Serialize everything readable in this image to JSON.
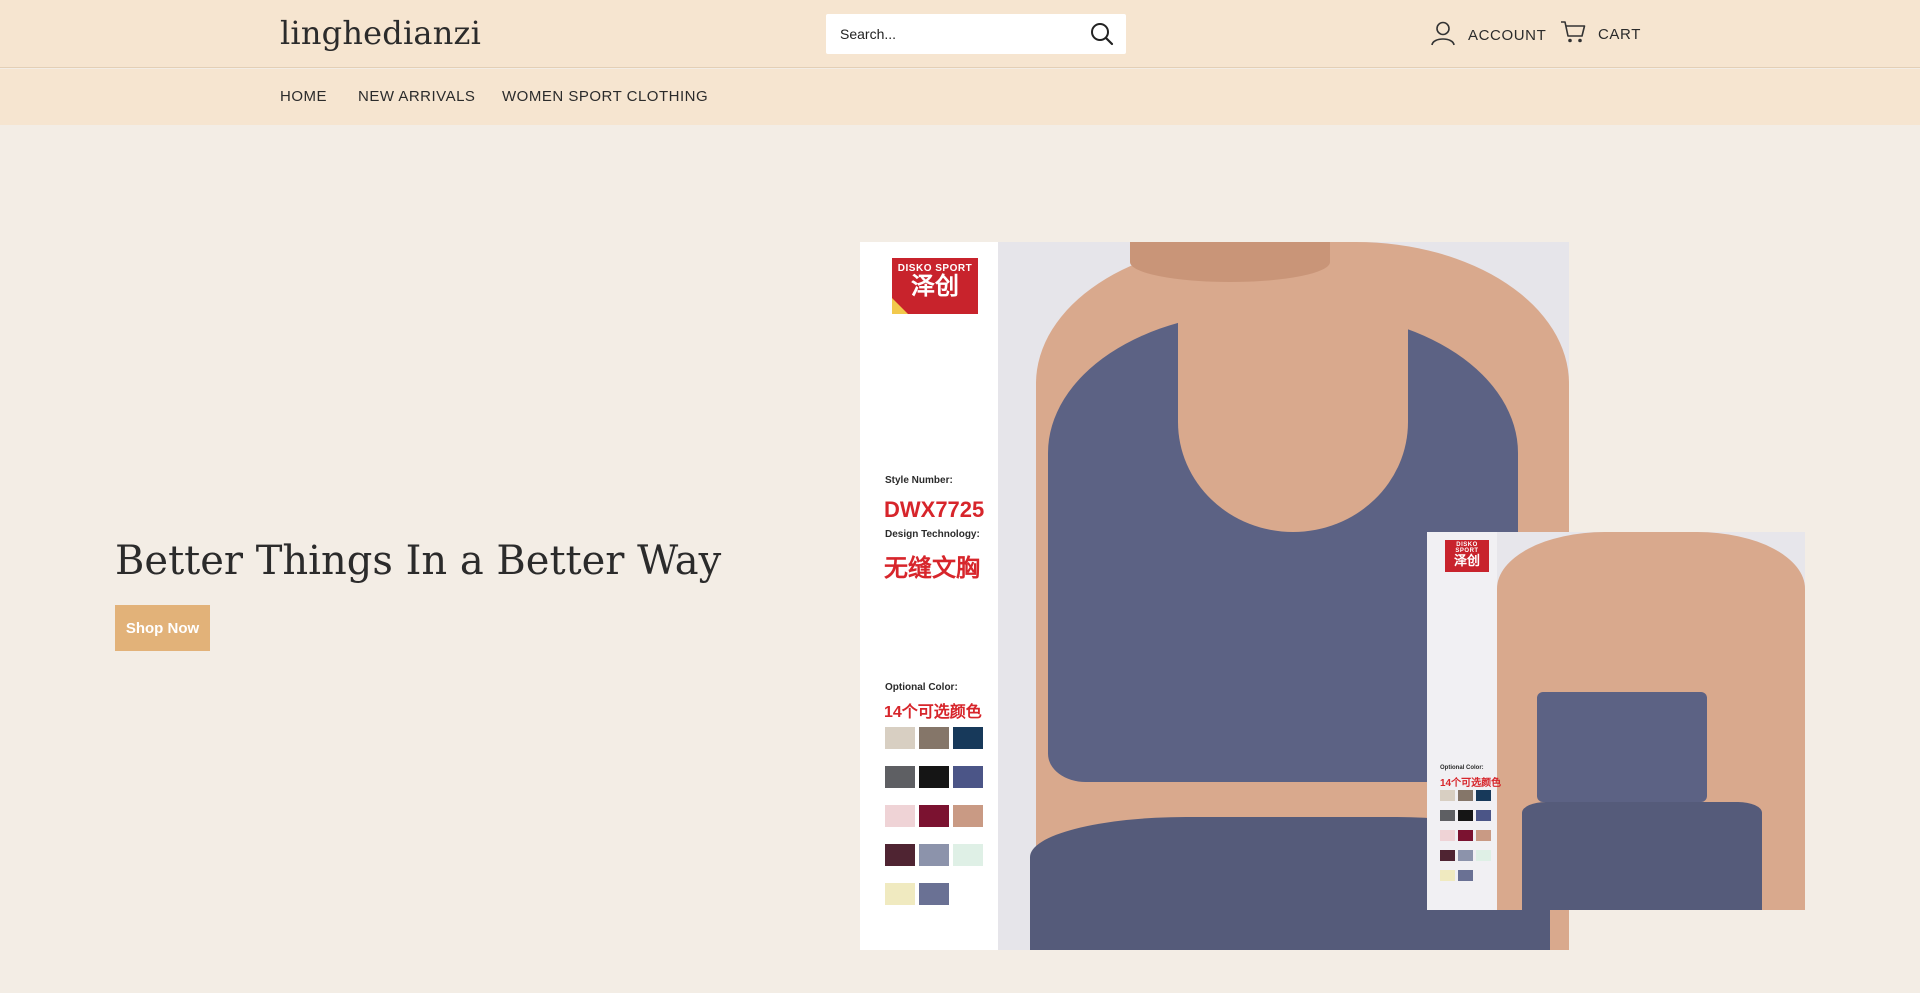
{
  "header": {
    "logo": "linghedianzi",
    "search_placeholder": "Search...",
    "account_label": "ACCOUNT",
    "cart_label": "CART"
  },
  "nav": {
    "items": [
      {
        "label": "HOME"
      },
      {
        "label": "NEW ARRIVALS"
      },
      {
        "label": "WOMEN SPORT CLOTHING"
      }
    ]
  },
  "hero": {
    "title": "Better Things In a Better Way",
    "button_label": "Shop Now"
  },
  "product_image": {
    "brand_en": "DISKO SPORT",
    "brand_cn": "泽创",
    "style_label": "Style Number:",
    "style_number": "DWX7725",
    "tech_label": "Design Technology:",
    "tech_value": "无缝文胸",
    "color_label": "Optional Color:",
    "color_value": "14个可选颜色",
    "swatch_colors": [
      "#d8cfc2",
      "#857669",
      "#17395a",
      "#5e5f63",
      "#151515",
      "#4b5587",
      "#efd3d6",
      "#7b1230",
      "#c99a84",
      "#4f2432",
      "#8c93ab",
      "#dff0e6",
      "#f0eac0",
      "#6a7194"
    ]
  },
  "colors": {
    "header_bg": "#f6e5d0",
    "page_bg": "#f3ede5",
    "button_bg": "#e2b279",
    "brand_red": "#c8232c"
  }
}
